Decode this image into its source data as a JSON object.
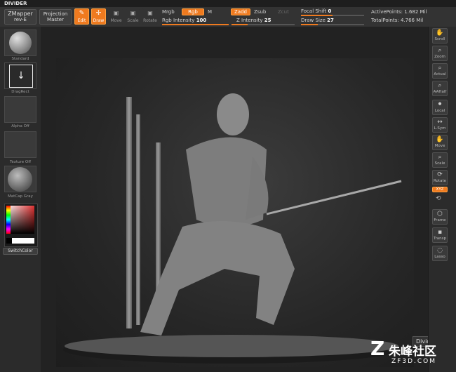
{
  "app_title": "DIVIDER",
  "topbar": {
    "zmapper": "ZMapper",
    "zmapper_sub": "rev-E",
    "projection": "Projection",
    "projection_sub": "Master",
    "edit": "Edit",
    "draw": "Draw",
    "move": "Move",
    "scale": "Scale",
    "rotate": "Rotate",
    "mrgb": "Mrgb",
    "rgb": "Rgb",
    "m": "M",
    "rgb_intensity_label": "Rgb Intensity",
    "rgb_intensity_value": "100",
    "zadd": "Zadd",
    "zsub": "Zsub",
    "zcut": "Zcut",
    "z_intensity_label": "Z Intensity",
    "z_intensity_value": "25",
    "focal_shift_label": "Focal Shift",
    "focal_shift_value": "0",
    "draw_size_label": "Draw Size",
    "draw_size_value": "27",
    "active_points_label": "ActivePoints:",
    "active_points_value": "1.682 Mil",
    "total_points_label": "TotalPoints:",
    "total_points_value": "4.766 Mil",
    "rgb_intensity_fraction": 1.0,
    "z_intensity_fraction": 0.25,
    "focal_shift_fraction": 0.5,
    "draw_size_fraction": 0.27
  },
  "left_shelf": {
    "brush": "Standard",
    "stroke": "DragRect",
    "alpha": "Alpha Off",
    "texture": "Texture Off",
    "material": "MatCap Gray",
    "switch_color": "SwitchColor"
  },
  "right_shelf": {
    "scroll": "Scroll",
    "zoom": "Zoom",
    "actual": "Actual",
    "aahalf": "AAHalf",
    "local": "Local",
    "lsym": "L.Sym",
    "move": "Move",
    "scale": "Scale",
    "rotate": "Rotate",
    "xyz": "XYZ",
    "frame": "Frame",
    "transp": "Transp",
    "lasso": "Lasso"
  },
  "canvas": {
    "divider_tab": "Divider"
  },
  "watermark": {
    "cn": "朱峰社区",
    "url": "ZF3D.COM"
  },
  "colors": {
    "accent": "#ef7a1f",
    "panel": "#2b2b2b"
  }
}
